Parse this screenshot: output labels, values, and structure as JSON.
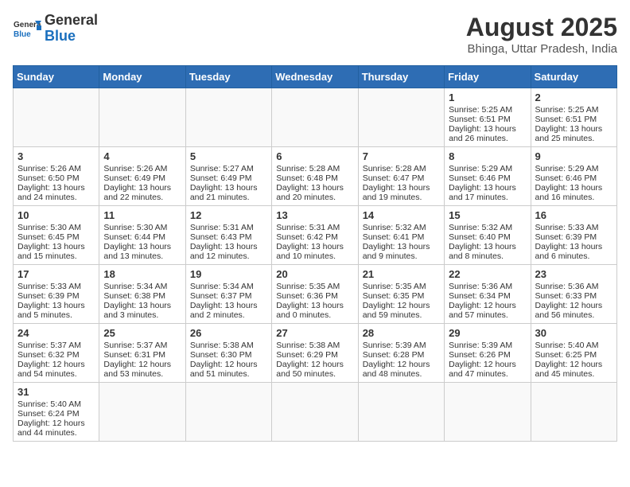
{
  "header": {
    "logo_general": "General",
    "logo_blue": "Blue",
    "month_year": "August 2025",
    "location": "Bhinga, Uttar Pradesh, India"
  },
  "weekdays": [
    "Sunday",
    "Monday",
    "Tuesday",
    "Wednesday",
    "Thursday",
    "Friday",
    "Saturday"
  ],
  "weeks": [
    [
      {
        "day": "",
        "info": ""
      },
      {
        "day": "",
        "info": ""
      },
      {
        "day": "",
        "info": ""
      },
      {
        "day": "",
        "info": ""
      },
      {
        "day": "",
        "info": ""
      },
      {
        "day": "1",
        "info": "Sunrise: 5:25 AM\nSunset: 6:51 PM\nDaylight: 13 hours and 26 minutes."
      },
      {
        "day": "2",
        "info": "Sunrise: 5:25 AM\nSunset: 6:51 PM\nDaylight: 13 hours and 25 minutes."
      }
    ],
    [
      {
        "day": "3",
        "info": "Sunrise: 5:26 AM\nSunset: 6:50 PM\nDaylight: 13 hours and 24 minutes."
      },
      {
        "day": "4",
        "info": "Sunrise: 5:26 AM\nSunset: 6:49 PM\nDaylight: 13 hours and 22 minutes."
      },
      {
        "day": "5",
        "info": "Sunrise: 5:27 AM\nSunset: 6:49 PM\nDaylight: 13 hours and 21 minutes."
      },
      {
        "day": "6",
        "info": "Sunrise: 5:28 AM\nSunset: 6:48 PM\nDaylight: 13 hours and 20 minutes."
      },
      {
        "day": "7",
        "info": "Sunrise: 5:28 AM\nSunset: 6:47 PM\nDaylight: 13 hours and 19 minutes."
      },
      {
        "day": "8",
        "info": "Sunrise: 5:29 AM\nSunset: 6:46 PM\nDaylight: 13 hours and 17 minutes."
      },
      {
        "day": "9",
        "info": "Sunrise: 5:29 AM\nSunset: 6:46 PM\nDaylight: 13 hours and 16 minutes."
      }
    ],
    [
      {
        "day": "10",
        "info": "Sunrise: 5:30 AM\nSunset: 6:45 PM\nDaylight: 13 hours and 15 minutes."
      },
      {
        "day": "11",
        "info": "Sunrise: 5:30 AM\nSunset: 6:44 PM\nDaylight: 13 hours and 13 minutes."
      },
      {
        "day": "12",
        "info": "Sunrise: 5:31 AM\nSunset: 6:43 PM\nDaylight: 13 hours and 12 minutes."
      },
      {
        "day": "13",
        "info": "Sunrise: 5:31 AM\nSunset: 6:42 PM\nDaylight: 13 hours and 10 minutes."
      },
      {
        "day": "14",
        "info": "Sunrise: 5:32 AM\nSunset: 6:41 PM\nDaylight: 13 hours and 9 minutes."
      },
      {
        "day": "15",
        "info": "Sunrise: 5:32 AM\nSunset: 6:40 PM\nDaylight: 13 hours and 8 minutes."
      },
      {
        "day": "16",
        "info": "Sunrise: 5:33 AM\nSunset: 6:39 PM\nDaylight: 13 hours and 6 minutes."
      }
    ],
    [
      {
        "day": "17",
        "info": "Sunrise: 5:33 AM\nSunset: 6:39 PM\nDaylight: 13 hours and 5 minutes."
      },
      {
        "day": "18",
        "info": "Sunrise: 5:34 AM\nSunset: 6:38 PM\nDaylight: 13 hours and 3 minutes."
      },
      {
        "day": "19",
        "info": "Sunrise: 5:34 AM\nSunset: 6:37 PM\nDaylight: 13 hours and 2 minutes."
      },
      {
        "day": "20",
        "info": "Sunrise: 5:35 AM\nSunset: 6:36 PM\nDaylight: 13 hours and 0 minutes."
      },
      {
        "day": "21",
        "info": "Sunrise: 5:35 AM\nSunset: 6:35 PM\nDaylight: 12 hours and 59 minutes."
      },
      {
        "day": "22",
        "info": "Sunrise: 5:36 AM\nSunset: 6:34 PM\nDaylight: 12 hours and 57 minutes."
      },
      {
        "day": "23",
        "info": "Sunrise: 5:36 AM\nSunset: 6:33 PM\nDaylight: 12 hours and 56 minutes."
      }
    ],
    [
      {
        "day": "24",
        "info": "Sunrise: 5:37 AM\nSunset: 6:32 PM\nDaylight: 12 hours and 54 minutes."
      },
      {
        "day": "25",
        "info": "Sunrise: 5:37 AM\nSunset: 6:31 PM\nDaylight: 12 hours and 53 minutes."
      },
      {
        "day": "26",
        "info": "Sunrise: 5:38 AM\nSunset: 6:30 PM\nDaylight: 12 hours and 51 minutes."
      },
      {
        "day": "27",
        "info": "Sunrise: 5:38 AM\nSunset: 6:29 PM\nDaylight: 12 hours and 50 minutes."
      },
      {
        "day": "28",
        "info": "Sunrise: 5:39 AM\nSunset: 6:28 PM\nDaylight: 12 hours and 48 minutes."
      },
      {
        "day": "29",
        "info": "Sunrise: 5:39 AM\nSunset: 6:26 PM\nDaylight: 12 hours and 47 minutes."
      },
      {
        "day": "30",
        "info": "Sunrise: 5:40 AM\nSunset: 6:25 PM\nDaylight: 12 hours and 45 minutes."
      }
    ],
    [
      {
        "day": "31",
        "info": "Sunrise: 5:40 AM\nSunset: 6:24 PM\nDaylight: 12 hours and 44 minutes."
      },
      {
        "day": "",
        "info": ""
      },
      {
        "day": "",
        "info": ""
      },
      {
        "day": "",
        "info": ""
      },
      {
        "day": "",
        "info": ""
      },
      {
        "day": "",
        "info": ""
      },
      {
        "day": "",
        "info": ""
      }
    ]
  ]
}
